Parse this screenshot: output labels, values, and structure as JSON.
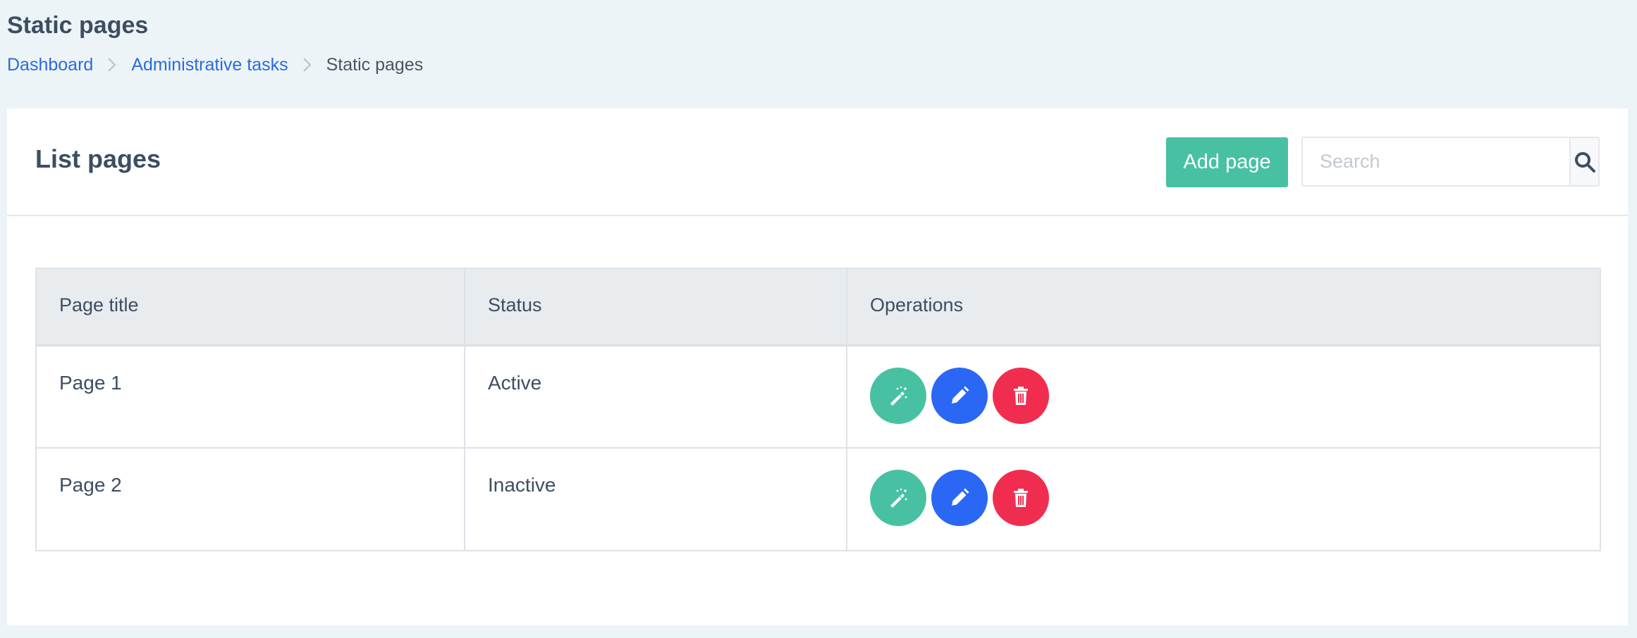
{
  "header": {
    "title": "Static pages",
    "breadcrumb": [
      {
        "label": "Dashboard"
      },
      {
        "label": "Administrative tasks"
      },
      {
        "label": "Static pages"
      }
    ]
  },
  "card": {
    "title": "List pages",
    "add_button_label": "Add page",
    "search": {
      "placeholder": "Search",
      "value": "",
      "icon": "search-icon"
    }
  },
  "table": {
    "columns": [
      "Page title",
      "Status",
      "Operations"
    ],
    "rows": [
      {
        "title": "Page 1",
        "status": "Active",
        "operations": [
          "magic-wand-icon",
          "pencil-icon",
          "trash-icon"
        ]
      },
      {
        "title": "Page 2",
        "status": "Inactive",
        "operations": [
          "magic-wand-icon",
          "pencil-icon",
          "trash-icon"
        ]
      }
    ]
  },
  "colors": {
    "accent_green": "#48c1a3",
    "accent_blue": "#2b67f5",
    "accent_red": "#f12d4f",
    "link_blue": "#2a6adf",
    "background": "#edf4f7"
  }
}
